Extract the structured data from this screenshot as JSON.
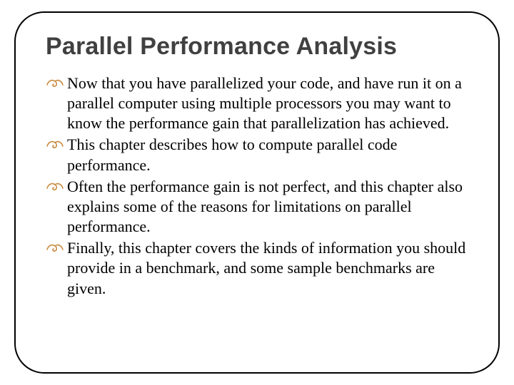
{
  "title": "Parallel Performance Analysis",
  "bullets": [
    "Now that you have parallelized your code, and have run it on a parallel computer using multiple processors you may want to know the performance gain that parallelization has achieved.",
    "This chapter describes how to compute parallel code performance.",
    "Often the performance gain is not perfect, and this chapter also explains some of the reasons for limitations on parallel performance.",
    "Finally, this chapter covers the kinds of information you should provide in a benchmark, and some sample benchmarks are given."
  ]
}
